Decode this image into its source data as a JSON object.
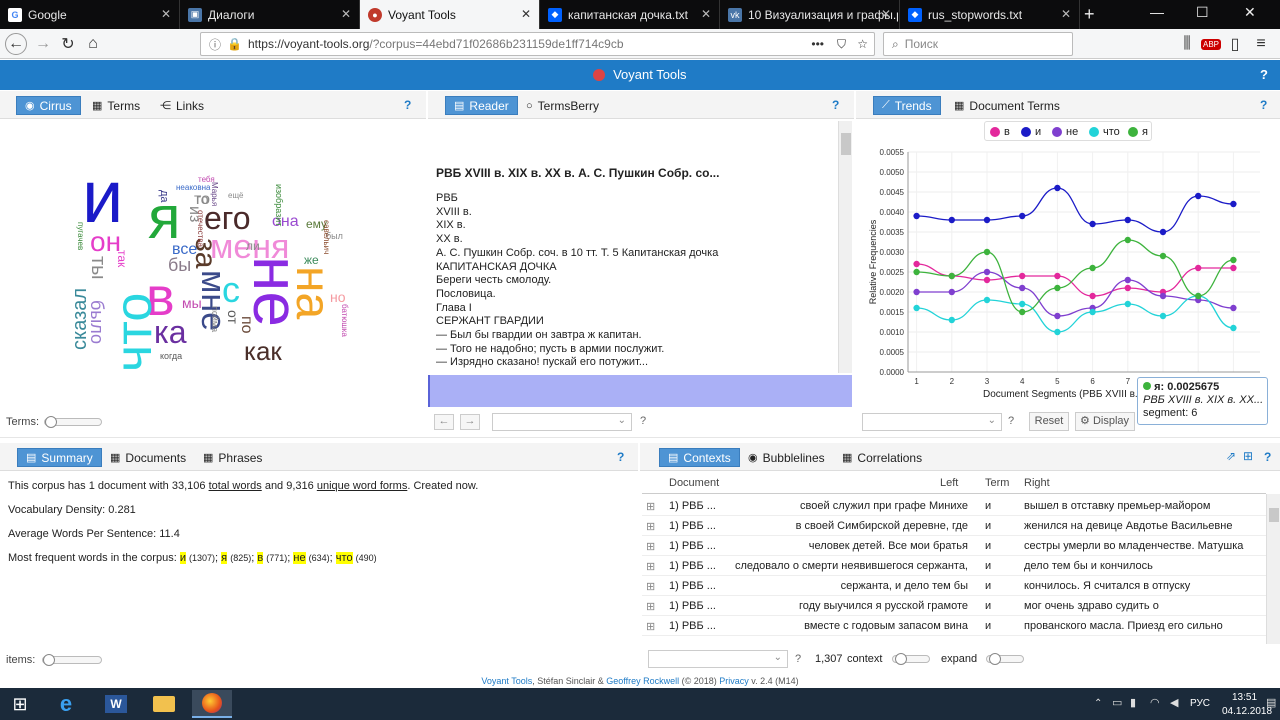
{
  "browser": {
    "tabs": [
      {
        "title": "Google",
        "color": "#4285f4",
        "icon": "G",
        "active": false
      },
      {
        "title": "Диалоги",
        "color": "#4a76a8",
        "icon": "▣",
        "active": false
      },
      {
        "title": "Voyant Tools",
        "color": "#c0392b",
        "icon": "●",
        "active": true
      },
      {
        "title": "капитанская дочка.txt",
        "color": "#0061fe",
        "icon": "◆",
        "active": false
      },
      {
        "title": "10 Визуализация и графы.pdf",
        "color": "#4a76a8",
        "icon": "vk",
        "active": false
      },
      {
        "title": "rus_stopwords.txt",
        "color": "#0061fe",
        "icon": "◆",
        "active": false
      }
    ],
    "url_host": "https://voyant-tools.org",
    "url_rest": "/?corpus=44ebd71f02686b231159de1ff714c9cb",
    "search_placeholder": "Поиск",
    "menu_dots": "•••"
  },
  "app": {
    "title": "Voyant Tools"
  },
  "cirrus_panel": {
    "tabs": [
      "Cirrus",
      "Terms",
      "Links"
    ],
    "help": "?",
    "terms_label": "Terms:",
    "words": [
      "и",
      "я",
      "его",
      "меня",
      "не",
      "на",
      "он",
      "в",
      "что",
      "мне",
      "ка",
      "как",
      "за",
      "с",
      "ты",
      "было",
      "сказал",
      "она",
      "бы",
      "все",
      "мы",
      "из",
      "ему",
      "то",
      "так",
      "же",
      "от",
      "по",
      "но",
      "да",
      "го",
      "тебя",
      "неаковна",
      "ещё",
      "был",
      "когда",
      "савельич",
      "Марья",
      "отечества",
      "пугачев",
      "ли",
      "изобразит",
      "батюшка",
      "пойма"
    ]
  },
  "reader_panel": {
    "tabs": [
      "Reader",
      "TermsBerry"
    ],
    "help": "?",
    "title": "РВБ XVIII в. XIX в. XX в. А. С. Пушкин Собр. со...",
    "lines": [
      "РВБ",
      "XVIII в.",
      "XIX в.",
      "XX в.",
      "А. С. Пушкин Собр. соч. в 10 тт. Т. 5 Капитанская дочка",
      "КАПИТАНСКАЯ ДОЧКА",
      "Береги честь смолоду.",
      "Пословица.",
      "Глава I",
      "СЕРЖАНТ ГВАРДИИ",
      "— Был бы гвардии он завтра ж капитан.",
      "— Того не надобно; пусть в армии послужит.",
      "— Изрядно сказано! пускай его потужит..."
    ]
  },
  "trends_panel": {
    "tabs": [
      "Trends",
      "Document Terms"
    ],
    "help": "?",
    "reset_label": "Reset",
    "display_label": "Display",
    "tooltip": {
      "term": "я: 0.0025675",
      "doc": "РВБ XVIII в. XIX в. XX...",
      "segment": "segment: 6"
    }
  },
  "chart_data": {
    "type": "line",
    "xlabel": "Document Segments (РВБ XVIII в. XI",
    "ylabel": "Relative Frequencies",
    "ylim": [
      0,
      0.0055
    ],
    "yticks": [
      "0.0000",
      "0.0005",
      "0.0010",
      "0.0015",
      "0.0020",
      "0.0025",
      "0.0030",
      "0.0035",
      "0.0040",
      "0.0045",
      "0.0050",
      "0.0055"
    ],
    "categories": [
      "1",
      "2",
      "3",
      "4",
      "5",
      "6",
      "7",
      "8",
      "9",
      "10"
    ],
    "series": [
      {
        "name": "в",
        "color": "#e3289c",
        "values": [
          0.0027,
          0.0024,
          0.0023,
          0.0024,
          0.0024,
          0.0019,
          0.0021,
          0.002,
          0.0026,
          0.0026
        ]
      },
      {
        "name": "и",
        "color": "#1b1bc7",
        "values": [
          0.0039,
          0.0038,
          0.0038,
          0.0039,
          0.0046,
          0.0037,
          0.0038,
          0.0035,
          0.0044,
          0.0042
        ]
      },
      {
        "name": "не",
        "color": "#7f3fcf",
        "values": [
          0.002,
          0.002,
          0.0025,
          0.0021,
          0.0014,
          0.0016,
          0.0023,
          0.0019,
          0.0018,
          0.0016
        ]
      },
      {
        "name": "что",
        "color": "#22d3d8",
        "values": [
          0.0016,
          0.0013,
          0.0018,
          0.0017,
          0.001,
          0.0015,
          0.0017,
          0.0014,
          0.0019,
          0.0011
        ]
      },
      {
        "name": "я",
        "color": "#3db33d",
        "values": [
          0.0025,
          0.0024,
          0.003,
          0.0015,
          0.0021,
          0.0026,
          0.0033,
          0.0029,
          0.0019,
          0.0028
        ]
      }
    ]
  },
  "summary_panel": {
    "tabs": [
      "Summary",
      "Documents",
      "Phrases"
    ],
    "help": "?",
    "line1_a": "This corpus has 1 document with 33,106 ",
    "line1_b": "total words",
    "line1_c": " and 9,316 ",
    "line1_d": "unique word forms",
    "line1_e": ". Created now.",
    "vocab": "Vocabulary Density: 0.281",
    "avg": "Average Words Per Sentence: 11.4",
    "freq_label": "Most frequent words in the corpus: ",
    "freq_words": [
      {
        "w": "и",
        "n": "(1307)"
      },
      {
        "w": "я",
        "n": "(825)"
      },
      {
        "w": "в",
        "n": "(771)"
      },
      {
        "w": "не",
        "n": "(634)"
      },
      {
        "w": "что",
        "n": "(490)"
      }
    ],
    "items_label": "items:"
  },
  "contexts_panel": {
    "tabs": [
      "Contexts",
      "Bubblelines",
      "Correlations"
    ],
    "help": "?",
    "headers": {
      "document": "Document",
      "left": "Left",
      "term": "Term",
      "right": "Right"
    },
    "rows": [
      {
        "doc": "1) РВБ ...",
        "left": "своей служил при графе Минихе",
        "term": "и",
        "right": "вышел в отставку премьер-майором"
      },
      {
        "doc": "1) РВБ ...",
        "left": "в своей Симбирской деревне, где",
        "term": "и",
        "right": "женился на девице Авдотье Васильевне"
      },
      {
        "doc": "1) РВБ ...",
        "left": "человек детей. Все мои братья",
        "term": "и",
        "right": "сестры умерли во младенчестве. Матушка"
      },
      {
        "doc": "1) РВБ ...",
        "left": "следовало о смерти неявившегося сержанта,",
        "term": "и",
        "right": "дело тем бы и кончилось"
      },
      {
        "doc": "1) РВБ ...",
        "left": "сержанта, и дело тем бы",
        "term": "и",
        "right": "кончилось. Я считался в отпуску"
      },
      {
        "doc": "1) РВБ ...",
        "left": "году выучился я русской грамоте",
        "term": "и",
        "right": "мог очень здраво судить о"
      },
      {
        "doc": "1) РВБ ...",
        "left": "вместе с годовым запасом вина",
        "term": "и",
        "right": "прованского масла. Приезд его сильно"
      }
    ],
    "count": "1,307",
    "context_label": "context",
    "expand_label": "expand"
  },
  "footer": {
    "a": "Voyant Tools",
    "b": ", Stéfan Sinclair & ",
    "c": "Geoffrey Rockwell",
    "d": " (© 2018) ",
    "e": "Privacy",
    "f": " v. 2.4 (M14)"
  },
  "taskbar": {
    "lang": "РУС",
    "time": "13:51",
    "date": "04.12.2018"
  }
}
